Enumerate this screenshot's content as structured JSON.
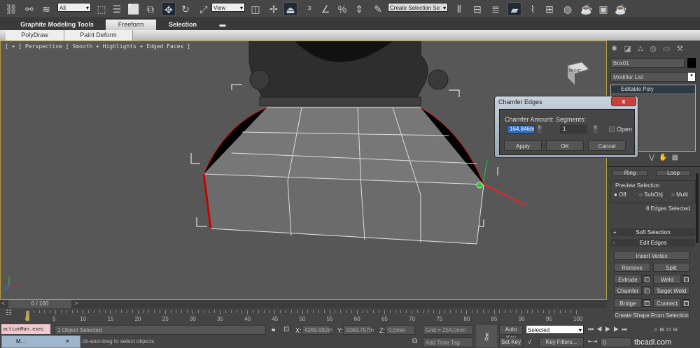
{
  "toolbar": {
    "selection_filter": "All",
    "reference_coord": "View",
    "named_selection": "Create Selection Se",
    "icons": [
      "link-icon",
      "unlink-icon",
      "bind-space-warp-icon",
      "select-object-icon",
      "select-by-name-icon",
      "rect-selection-icon",
      "window-crossing-icon",
      "move-icon",
      "rotate-icon",
      "scale-icon",
      "pivot-icon",
      "manipulate-icon",
      "keyboard-shortcut-icon",
      "snap-3-icon",
      "angle-snap-icon",
      "percent-snap-icon",
      "spinner-snap-icon",
      "edit-named-selection-icon",
      "mirror-icon",
      "align-icon",
      "layer-manager-icon",
      "graphite-toggle-icon",
      "curve-editor-icon",
      "schematic-view-icon",
      "material-editor-icon",
      "render-setup-icon",
      "rendered-frame-icon",
      "render-icon"
    ]
  },
  "ribbon": {
    "tabs": [
      "Graphite Modeling Tools",
      "Freeform",
      "Selection"
    ],
    "active_tab": "Freeform",
    "sub_buttons": [
      "PolyDraw",
      "Paint Deform"
    ]
  },
  "viewport": {
    "label": "[ + ] Perspective [ Smooth + Highlights + Edged Faces ]",
    "viewcube_label": "FRONT"
  },
  "dialog": {
    "title": "Chamfer Edges",
    "amount_label": "Chamfer Amount:",
    "amount_value": "164.846m",
    "segments_label": "Segments:",
    "segments_value": "1",
    "open_label": "Open",
    "open_checked": false,
    "apply": "Apply",
    "ok": "OK",
    "cancel": "Cancel"
  },
  "panel": {
    "object_name": "Box01",
    "object_color": "#000000",
    "modifier_list": "Modifier List",
    "stack": [
      "Editable Poly"
    ],
    "ring": "Ring",
    "loop": "Loop",
    "preview_title": "Preview Selection",
    "preview_options": [
      "Off",
      "SubObj",
      "Multi"
    ],
    "preview_selected": "Off",
    "selection_info": "8 Edges Selected",
    "soft_selection": "Soft Selection",
    "edit_edges": "Edit Edges",
    "buttons": {
      "insert_vertex": "Insert Vertex",
      "remove": "Remove",
      "split": "Split",
      "extrude": "Extrude",
      "weld": "Weld",
      "chamfer": "Chamfer",
      "target_weld": "Target Weld",
      "bridge": "Bridge",
      "connect": "Connect",
      "create_shape": "Create Shape From Selection"
    }
  },
  "timeline": {
    "frame": "0 / 100",
    "ticks": [
      "0",
      "5",
      "10",
      "15",
      "20",
      "25",
      "30",
      "35",
      "40",
      "45",
      "50",
      "55",
      "60",
      "65",
      "70",
      "75",
      "80",
      "85",
      "90",
      "95",
      "100"
    ]
  },
  "status": {
    "script_listener": "actionMan.exec",
    "taskbar_item": "M...",
    "selection": "1 Object Selected",
    "prompt": "ck-and-drag to select objects",
    "x_label": "X:",
    "x_value": "4289.692m",
    "y_label": "Y:",
    "y_value": "3269.757m",
    "z_label": "Z:",
    "z_value": "0.0mm",
    "grid": "Grid = 254.0mm",
    "add_time_tag": "Add Time Tag",
    "auto_key": "Auto Key",
    "set_key": "Set Key",
    "key_mode": "Selected",
    "key_filters": "Key Filters...",
    "current_frame": "0",
    "watermark": "tbcadl.com"
  }
}
